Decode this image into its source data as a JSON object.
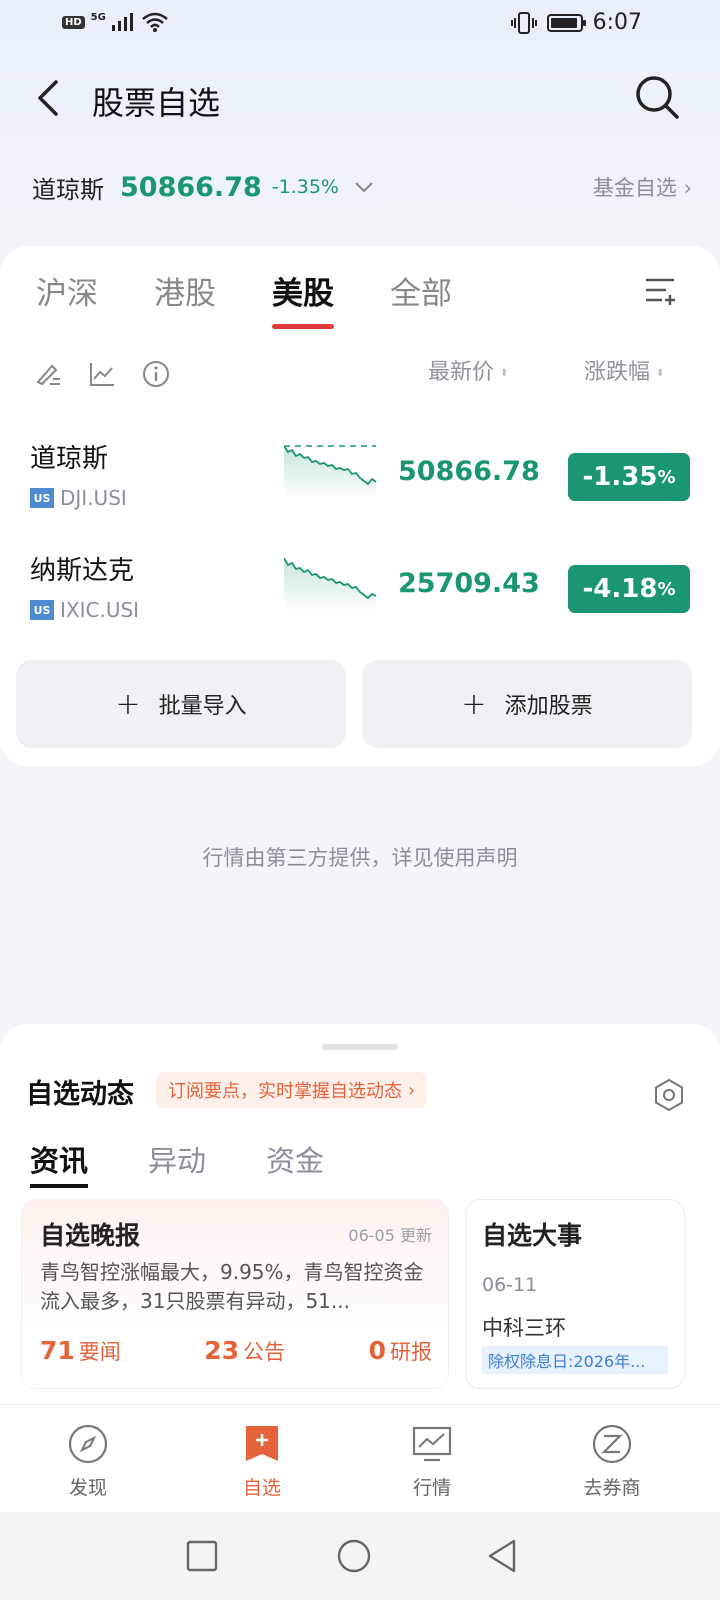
{
  "status": {
    "signal": "5G",
    "hd": "HD",
    "time": "6:07"
  },
  "header": {
    "title": "股票自选",
    "back_icon": "chevron-left-icon",
    "search_icon": "search-icon"
  },
  "index_line": {
    "name": "道琼斯",
    "price": "50866.78",
    "change": "-1.35%",
    "fund_link": "基金自选"
  },
  "tabs": [
    {
      "label": "沪深",
      "active": false
    },
    {
      "label": "港股",
      "active": false
    },
    {
      "label": "美股",
      "active": true
    },
    {
      "label": "全部",
      "active": false
    }
  ],
  "columns": {
    "price": "最新价",
    "change": "涨跌幅"
  },
  "stocks": [
    {
      "name": "道琼斯",
      "market": "US",
      "code": "DJI.USI",
      "price": "50866.78",
      "change": "-1.35",
      "pct": "%"
    },
    {
      "name": "纳斯达克",
      "market": "US",
      "code": "IXIC.USI",
      "price": "25709.43",
      "change": "-4.18",
      "pct": "%"
    }
  ],
  "actions": {
    "import": "批量导入",
    "add": "添加股票"
  },
  "disclaimer": "行情由第三方提供，详见使用声明",
  "sheet": {
    "title": "自选动态",
    "subscribe": "订阅要点，实时掌握自选动态",
    "tabs": [
      {
        "label": "资讯",
        "active": true
      },
      {
        "label": "异动",
        "active": false
      },
      {
        "label": "资金",
        "active": false
      }
    ],
    "news": {
      "title": "自选晚报",
      "date": "06-05 更新",
      "body": "青鸟智控涨幅最大，9.95%，青鸟智控资金流入最多，31只股票有异动，51...",
      "stats": [
        {
          "count": "71",
          "label": "要闻"
        },
        {
          "count": "23",
          "label": "公告"
        },
        {
          "count": "0",
          "label": "研报"
        }
      ]
    },
    "event": {
      "title": "自选大事",
      "date": "06-11",
      "company": "中科三环",
      "tag": "除权除息日:2026年..."
    }
  },
  "tabbar": [
    {
      "label": "发现",
      "icon": "compass-icon",
      "active": false
    },
    {
      "label": "自选",
      "icon": "bookmark-plus-icon",
      "active": true
    },
    {
      "label": "行情",
      "icon": "chart-monitor-icon",
      "active": false
    },
    {
      "label": "去券商",
      "icon": "broker-icon",
      "active": false
    }
  ],
  "colors": {
    "down": "#1a9672",
    "accent": "#e4633a",
    "tab_underline": "#e03a3a"
  }
}
